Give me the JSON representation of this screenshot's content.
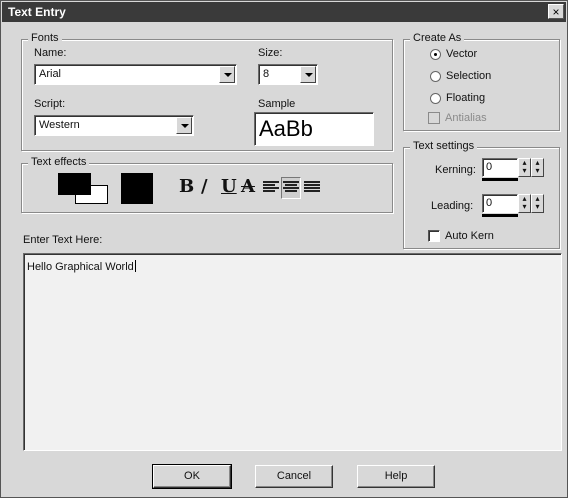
{
  "window": {
    "title": "Text Entry",
    "close_glyph": "×"
  },
  "fonts": {
    "legend": "Fonts",
    "name_label": "Name:",
    "name_value": "Arial",
    "size_label": "Size:",
    "size_value": "8",
    "script_label": "Script:",
    "script_value": "Western",
    "sample_label": "Sample",
    "sample_text": "AaBb"
  },
  "create_as": {
    "legend": "Create As",
    "options": [
      {
        "label": "Vector",
        "selected": true
      },
      {
        "label": "Selection",
        "selected": false
      },
      {
        "label": "Floating",
        "selected": false
      }
    ],
    "antialias_label": "Antialias",
    "antialias_enabled": false
  },
  "text_effects": {
    "legend": "Text effects",
    "bold_glyph": "B",
    "italic_glyph": "/",
    "underline_glyph": "U",
    "strike_glyph": "A",
    "colors": {
      "stroke": "#000000",
      "fill": "#000000",
      "background": "#ffffff"
    }
  },
  "text_settings": {
    "legend": "Text settings",
    "kerning_label": "Kerning:",
    "kerning_value": "0",
    "leading_label": "Leading:",
    "leading_value": "0",
    "auto_kern_label": "Auto Kern"
  },
  "entry": {
    "label": "Enter Text Here:",
    "text": "Hello Graphical World"
  },
  "buttons": {
    "ok": "OK",
    "cancel": "Cancel",
    "help": "Help"
  }
}
